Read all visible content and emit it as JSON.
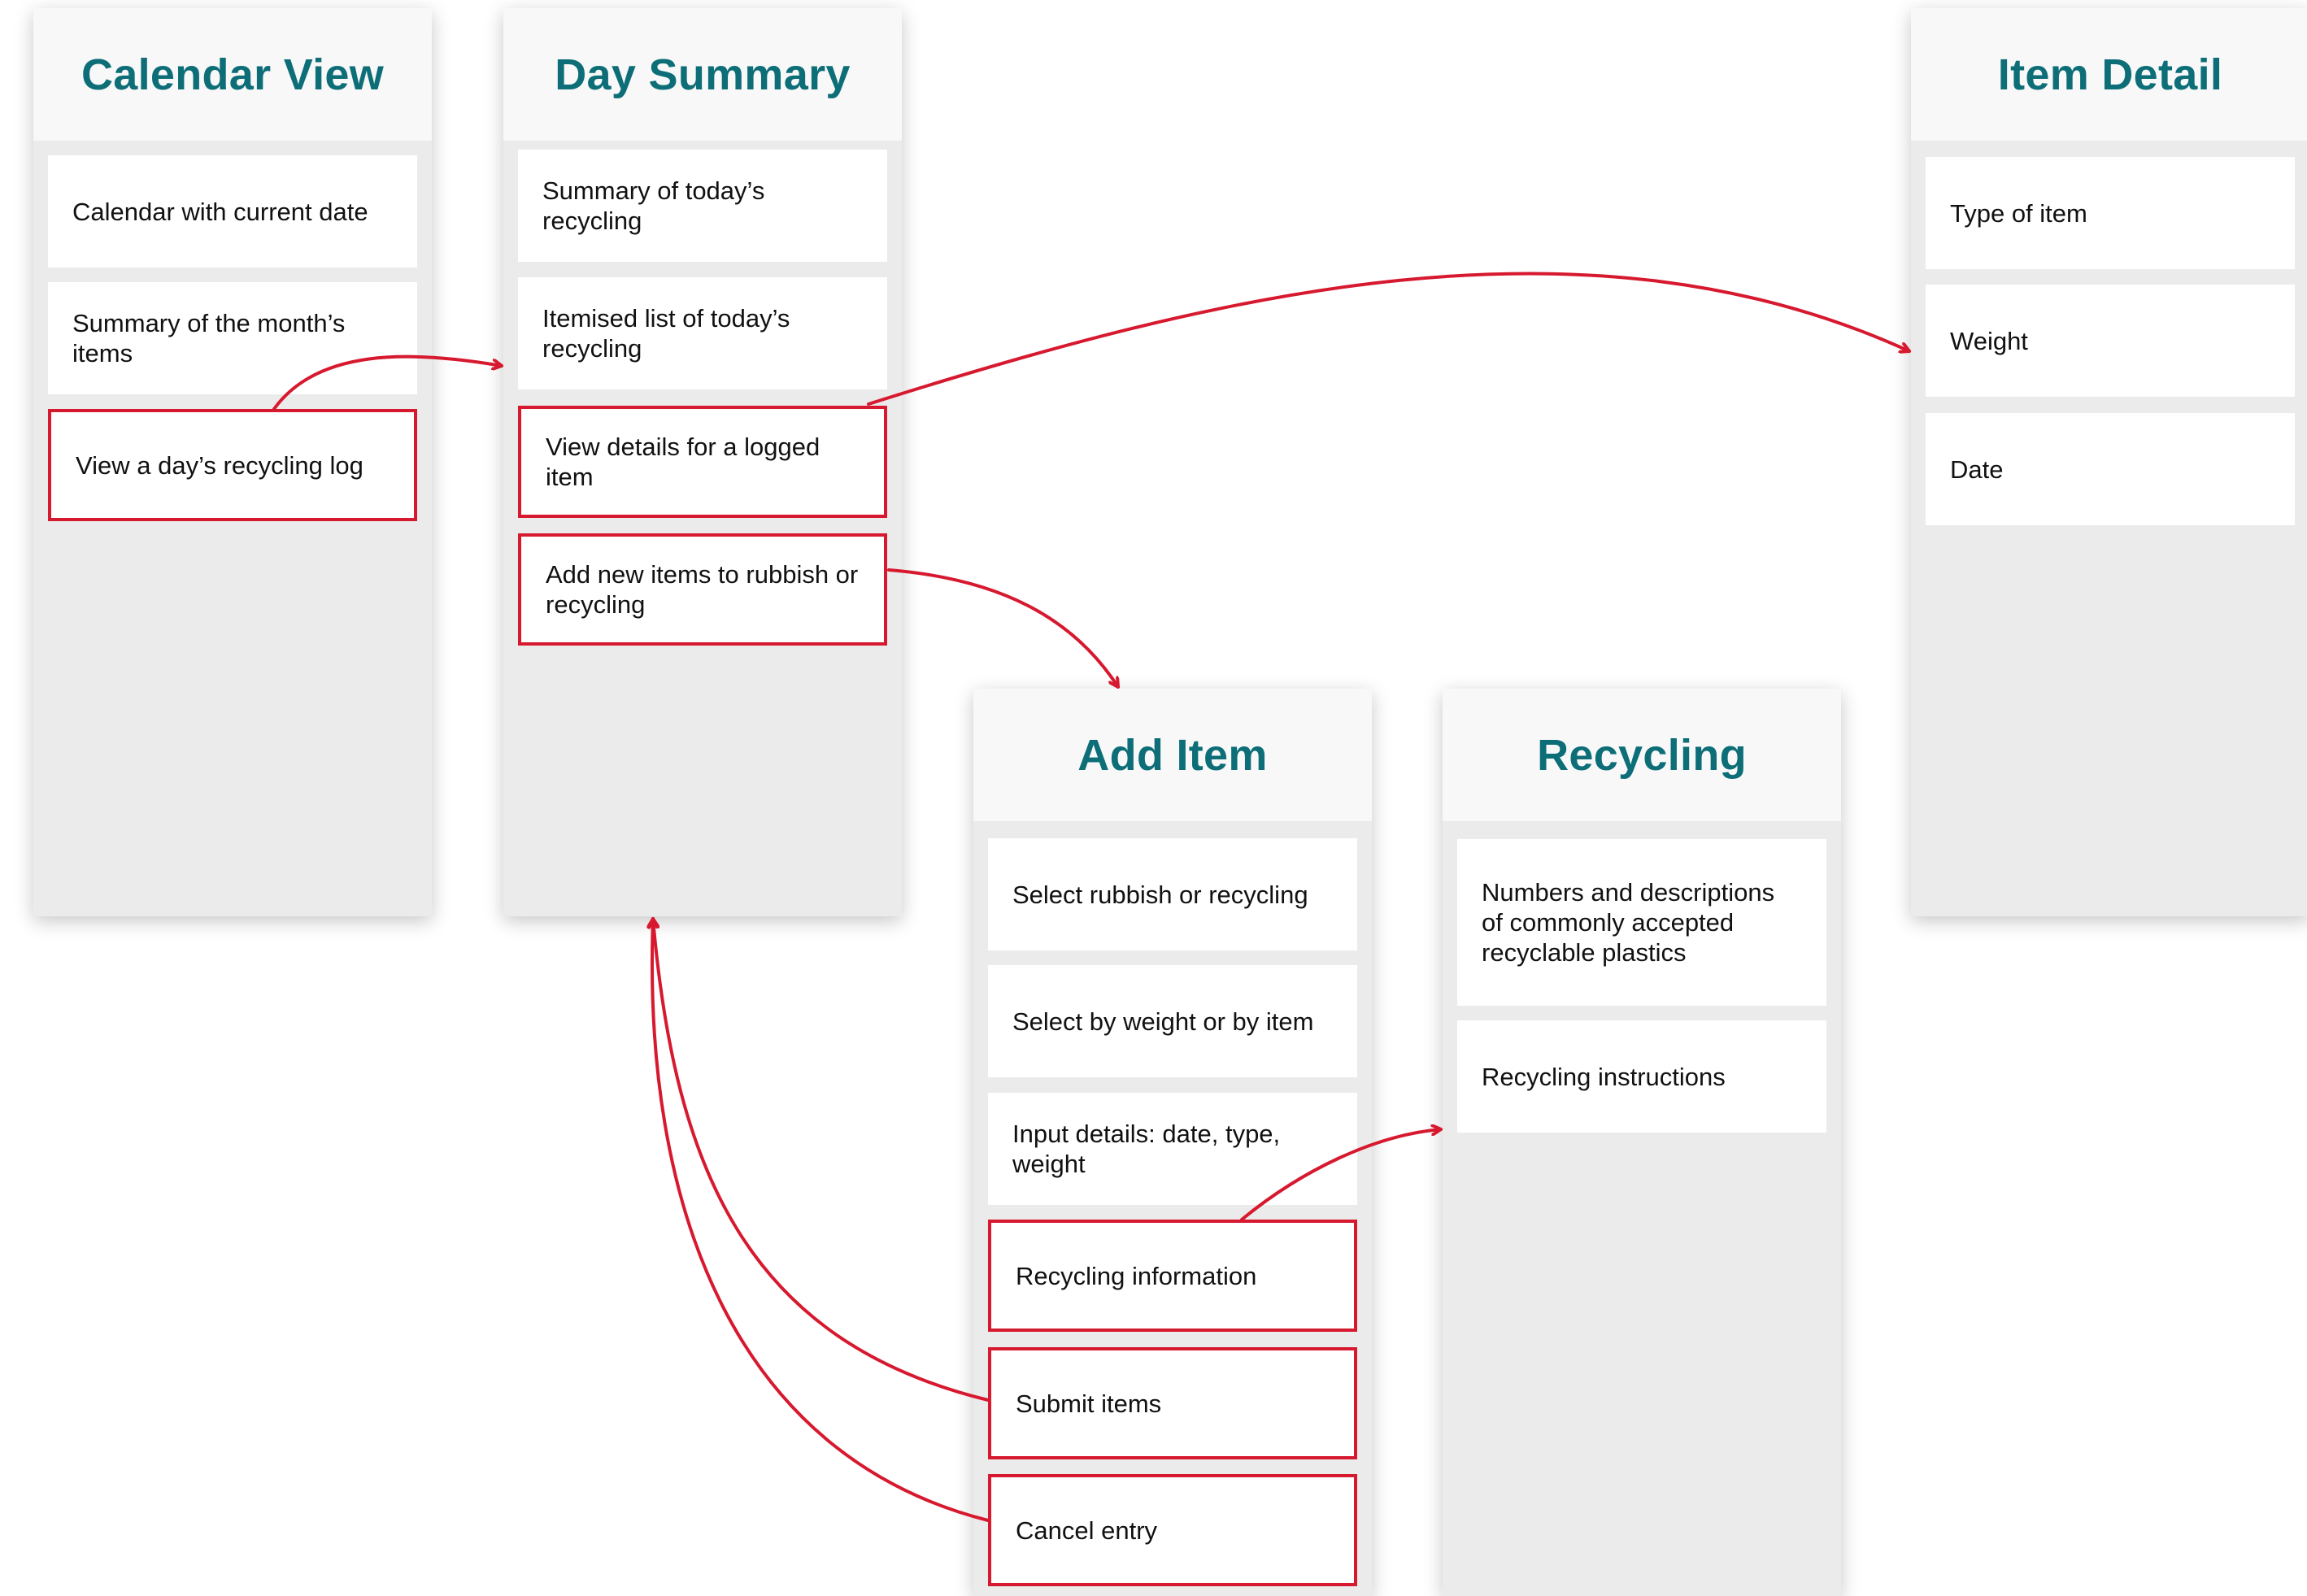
{
  "colors": {
    "heading": "#0d6e78",
    "highlight": "#d7192f",
    "column_bg": "#ebebeb",
    "header_bg": "#f8f8f8"
  },
  "screens": {
    "calendar": {
      "title": "Calendar View",
      "items": [
        "Calendar with current date",
        "Summary of the month’s items",
        "View a day’s recycling log"
      ]
    },
    "day_summary": {
      "title": "Day Summary",
      "items": [
        "Summary of today’s recycling",
        "Itemised list of today’s recycling",
        "View details for a logged item",
        "Add new items to rubbish or recycling"
      ]
    },
    "item_detail": {
      "title": "Item Detail",
      "items": [
        "Type of item",
        "Weight",
        "Date"
      ]
    },
    "add_item": {
      "title": "Add Item",
      "items": [
        "Select rubbish or recycling",
        "Select by weight or by item",
        "Input details: date, type, weight",
        "Recycling information",
        "Submit items",
        "Cancel entry"
      ]
    },
    "recycling": {
      "title": "Recycling",
      "items": [
        "Numbers and descriptions of commonly accepted recyclable plastics",
        "Recycling instructions"
      ]
    }
  },
  "flows": [
    {
      "from": "View a day’s recycling log",
      "to": "Day Summary"
    },
    {
      "from": "View details for a logged item",
      "to": "Item Detail"
    },
    {
      "from": "Add new items to rubbish or recycling",
      "to": "Add Item"
    },
    {
      "from": "Recycling information",
      "to": "Recycling"
    },
    {
      "from": "Submit items",
      "to": "Day Summary"
    },
    {
      "from": "Cancel entry",
      "to": "Day Summary"
    }
  ]
}
